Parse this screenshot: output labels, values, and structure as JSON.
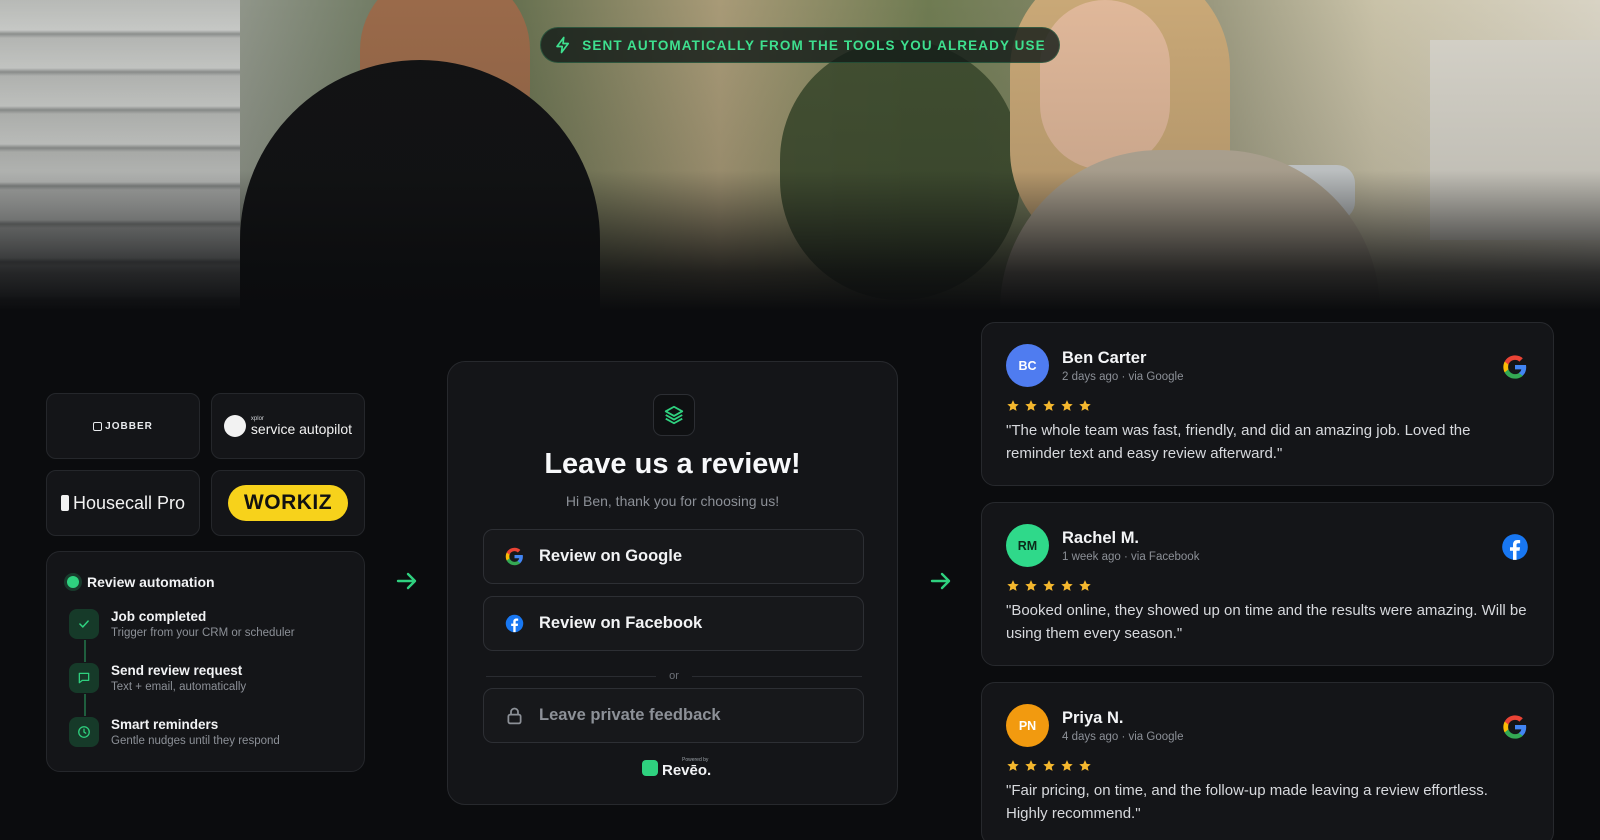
{
  "banner": {
    "text": "SENT AUTOMATICALLY FROM THE TOOLS YOU ALREADY USE"
  },
  "integrations": {
    "jobber": "JOBBER",
    "service_autopilot_small": "xplor",
    "service_autopilot": "service autopilot",
    "housecall_pro": "Housecall Pro",
    "workiz": "WORKIZ"
  },
  "automation": {
    "title": "Review automation",
    "steps": [
      {
        "title": "Job completed",
        "subtitle": "Trigger from your CRM or scheduler",
        "icon": "check-icon"
      },
      {
        "title": "Send review request",
        "subtitle": "Text + email, automatically",
        "icon": "chat-icon"
      },
      {
        "title": "Smart reminders",
        "subtitle": "Gentle nudges until they respond",
        "icon": "clock-icon"
      }
    ]
  },
  "review_card": {
    "title": "Leave us a review!",
    "subtitle": "Hi Ben, thank you for choosing us!",
    "google_button": "Review on Google",
    "facebook_button": "Review on Facebook",
    "or": "or",
    "private_button": "Leave private feedback",
    "powered_by": "Powered by",
    "brand": "Revēo."
  },
  "reviews": [
    {
      "initials": "BC",
      "name": "Ben Carter",
      "meta": "2 days ago · via Google",
      "source": "google-icon",
      "rating": 5,
      "avatar_color": "#4f7cf0",
      "quote": "\"The whole team was fast, friendly, and did an amazing job. Loved the reminder text and easy review afterward.\""
    },
    {
      "initials": "RM",
      "name": "Rachel M.",
      "meta": "1 week ago · via Facebook",
      "source": "facebook-icon",
      "rating": 5,
      "avatar_color": "#2fd98a",
      "quote": "\"Booked online, they showed up on time and the results were amazing. Will be using them every season.\""
    },
    {
      "initials": "PN",
      "name": "Priya N.",
      "meta": "4 days ago · via Google",
      "source": "google-icon",
      "rating": 5,
      "avatar_color": "#f29a0f",
      "quote": "\"Fair pricing, on time, and the follow-up made leaving a review effortless. Highly recommend.\""
    }
  ],
  "colors": {
    "accent": "#2fd17f",
    "star": "#f5b82e",
    "background": "#0b0c0e"
  }
}
